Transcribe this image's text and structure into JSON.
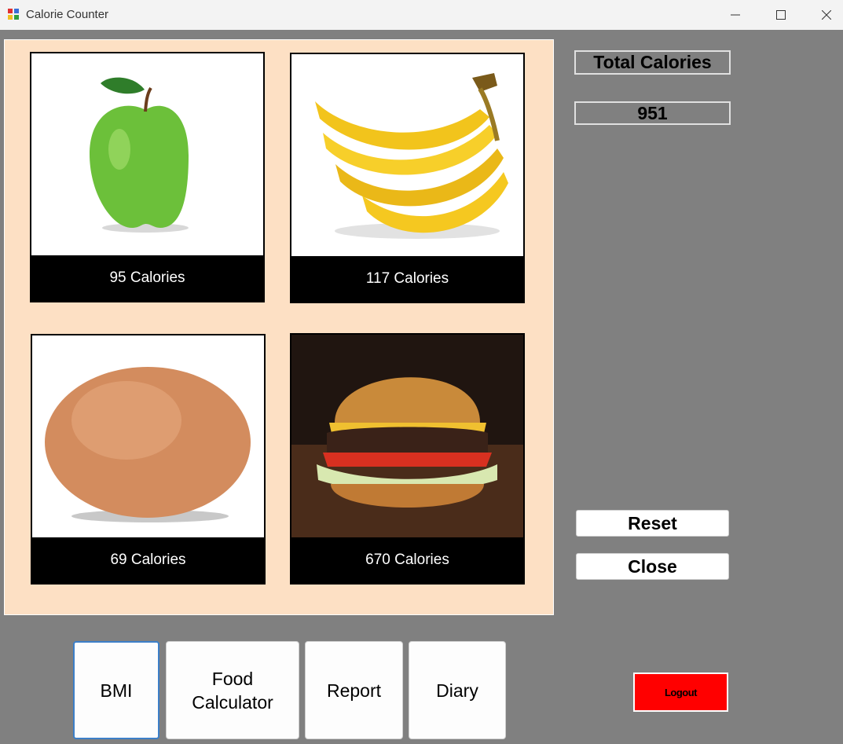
{
  "window": {
    "title": "Calorie Counter"
  },
  "foods": [
    {
      "icon": "apple-icon",
      "calories_label": "95 Calories"
    },
    {
      "icon": "banana-icon",
      "calories_label": "117 Calories"
    },
    {
      "icon": "egg-icon",
      "calories_label": "69 Calories"
    },
    {
      "icon": "burger-icon",
      "calories_label": "670 Calories"
    }
  ],
  "total": {
    "label": "Total Calories",
    "value": "951"
  },
  "actions": {
    "reset": "Reset",
    "close": "Close",
    "logout": "Logout"
  },
  "nav": {
    "bmi": "BMI",
    "food_calculator": "Food\nCalculator",
    "report": "Report",
    "diary": "Diary"
  },
  "colors": {
    "panel": "#fde0c4",
    "background": "#808080",
    "logout": "#ff0000"
  }
}
